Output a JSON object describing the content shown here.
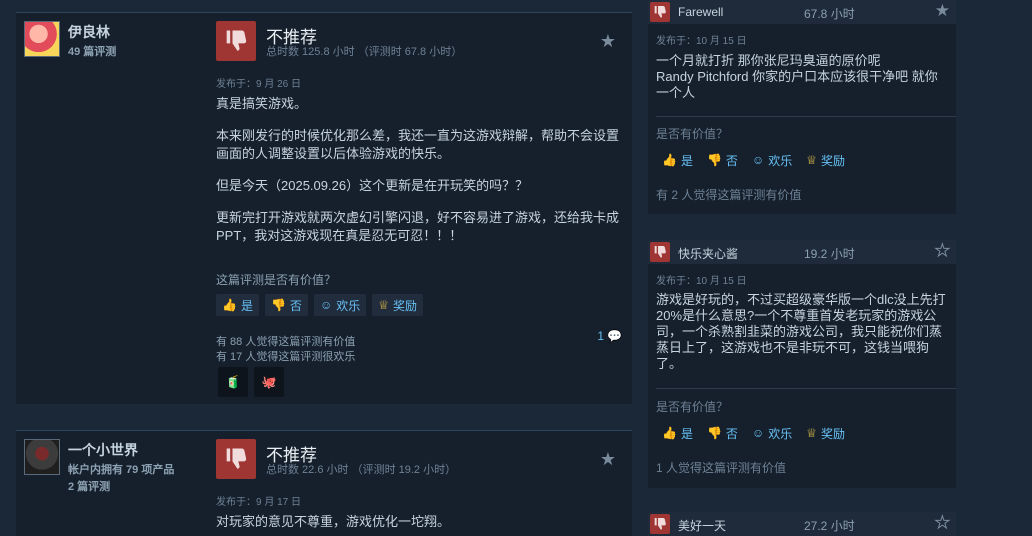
{
  "reviews": [
    {
      "author": "伊良林",
      "author_sub1": "49 篇评测",
      "recommendation": "不推荐",
      "hours": "总时数 125.8 小时 （评测时 67.8 小时）",
      "posted": "发布于：9 月 26 日",
      "paragraphs": [
        "真是搞笑游戏。",
        "本来刚发行的时候优化那么差，我还一直为这游戏辩解，帮助不会设置画面的人调整设置以后体验游戏的快乐。",
        "但是今天（2025.09.26）这个更新是在开玩笑的吗？？",
        "更新完打开游戏就两次虚幻引擎闪退，好不容易进了游戏，还给我卡成PPT，我对这游戏现在真是忍无可忍！！！"
      ],
      "helpful_q": "这篇评测是否有价值？",
      "btn_yes": "是",
      "btn_no": "否",
      "btn_funny": "欢乐",
      "btn_award": "奖励",
      "helpful_stat": "有 88 人觉得这篇评测有价值",
      "funny_stat": "有 17 人觉得这篇评测很欢乐",
      "comment_count": "1"
    },
    {
      "author": "一个小世界",
      "author_sub1": "帐户内拥有 79 项产品",
      "author_sub2": "2 篇评测",
      "recommendation": "不推荐",
      "hours": "总时数 22.6 小时 （评测时 19.2 小时）",
      "posted": "发布于：9 月 17 日",
      "paragraphs": [
        "对玩家的意见不尊重，游戏优化一坨翔。"
      ]
    }
  ],
  "side": [
    {
      "name": "Farewell",
      "hours": "67.8 小时",
      "posted": "发布于：10 月 15 日",
      "text": "一个月就打折 那你张尼玛臭逼的原价呢\nRandy Pitchford 你家的户口本应该很干净吧 就你一个人",
      "helpful_q": "是否有价值？",
      "btn_yes": "是",
      "btn_no": "否",
      "btn_funny": "欢乐",
      "btn_award": "奖励",
      "stat": "有 2 人觉得这篇评测有价值"
    },
    {
      "name": "快乐夹心酱",
      "hours": "19.2 小时",
      "posted": "发布于：10 月 15 日",
      "text": "游戏是好玩的，不过买超级豪华版一个dlc没上先打20%是什么意思?一个不尊重首发老玩家的游戏公司，一个杀熟割韭菜的游戏公司，我只能祝你们蒸蒸日上了，这游戏也不是非玩不可，这钱当喂狗了。",
      "helpful_q": "是否有价值？",
      "btn_yes": "是",
      "btn_no": "否",
      "btn_funny": "欢乐",
      "btn_award": "奖励",
      "stat": "1 人觉得这篇评测有价值"
    },
    {
      "name": "美好一天",
      "hours": "27.2 小时"
    }
  ]
}
